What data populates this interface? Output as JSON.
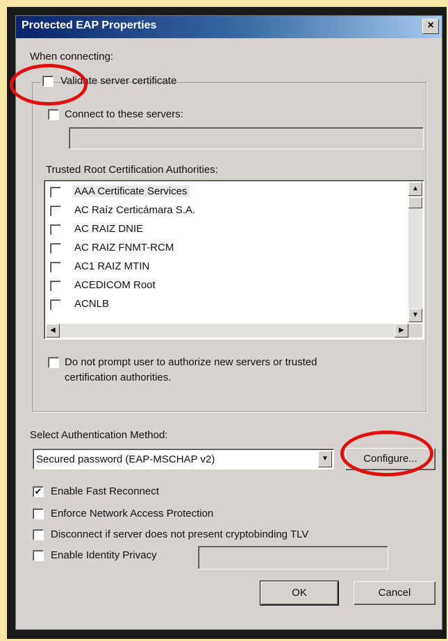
{
  "window": {
    "title": "Protected EAP Properties",
    "close_glyph": "×"
  },
  "when_connecting_label": "When connecting:",
  "validate_certificate": {
    "label": "Validate server certificate",
    "checked": false
  },
  "connect_to_servers": {
    "label": "Connect to these servers:",
    "checked": false,
    "value": ""
  },
  "trusted_roots": {
    "label": "Trusted Root Certification Authorities:",
    "items": [
      {
        "label": "AAA Certificate Services",
        "checked": false,
        "selected": true
      },
      {
        "label": "AC Raíz Certicámara S.A.",
        "checked": false,
        "selected": false
      },
      {
        "label": "AC RAIZ DNIE",
        "checked": false,
        "selected": false
      },
      {
        "label": "AC RAIZ FNMT-RCM",
        "checked": false,
        "selected": false
      },
      {
        "label": "AC1 RAIZ MTIN",
        "checked": false,
        "selected": false
      },
      {
        "label": "ACEDICOM Root",
        "checked": false,
        "selected": false
      },
      {
        "label": "ACNLB",
        "checked": false,
        "selected": false
      }
    ],
    "scroll_up": "▲",
    "scroll_down": "▼",
    "scroll_left": "◀",
    "scroll_right": "▶"
  },
  "do_not_prompt": {
    "line1": "Do not prompt user to authorize new servers or trusted",
    "line2": "certification authorities.",
    "checked": false
  },
  "auth_method": {
    "label": "Select Authentication Method:",
    "selected": "Secured password (EAP-MSCHAP v2)",
    "dropdown_glyph": "▼",
    "configure_label": "Configure..."
  },
  "options": [
    {
      "label": "Enable Fast Reconnect",
      "checked": true
    },
    {
      "label": "Enforce Network Access Protection",
      "checked": false
    },
    {
      "label": "Disconnect if server does not present cryptobinding TLV",
      "checked": false
    },
    {
      "label": "Enable Identity Privacy",
      "checked": false
    }
  ],
  "identity_privacy_value": "",
  "buttons": {
    "ok": "OK",
    "cancel": "Cancel"
  },
  "check_glyph": "✔",
  "colors": {
    "highlight_circle": "#e01010",
    "titlebar": "#0a246a",
    "dialog_bg": "#d6d3ce"
  }
}
